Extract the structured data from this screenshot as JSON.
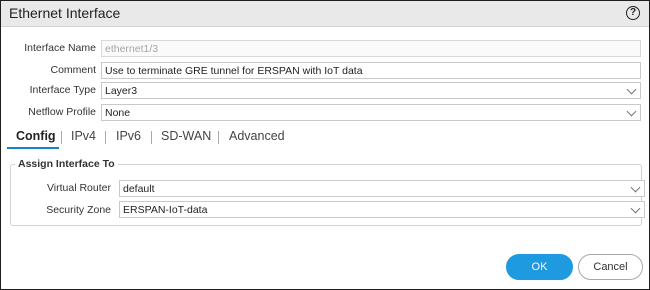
{
  "dialog": {
    "title": "Ethernet Interface",
    "help_icon": "?"
  },
  "fields": {
    "interface_name": {
      "label": "Interface Name",
      "value": "ethernet1/3"
    },
    "comment": {
      "label": "Comment",
      "value": "Use to terminate GRE tunnel for ERSPAN with IoT data"
    },
    "interface_type": {
      "label": "Interface Type",
      "value": "Layer3"
    },
    "netflow_profile": {
      "label": "Netflow Profile",
      "value": "None"
    }
  },
  "tabs": [
    {
      "label": "Config",
      "active": true
    },
    {
      "label": "IPv4"
    },
    {
      "label": "IPv6"
    },
    {
      "label": "SD-WAN"
    },
    {
      "label": "Advanced"
    }
  ],
  "assign_group": {
    "legend": "Assign Interface To",
    "virtual_router": {
      "label": "Virtual Router",
      "value": "default"
    },
    "security_zone": {
      "label": "Security Zone",
      "value": "ERSPAN-IoT-data"
    }
  },
  "buttons": {
    "ok": "OK",
    "cancel": "Cancel"
  },
  "colors": {
    "accent": "#1e9be0",
    "tab_underline": "#1a82c7",
    "titlebar": "#e9e9e9"
  }
}
